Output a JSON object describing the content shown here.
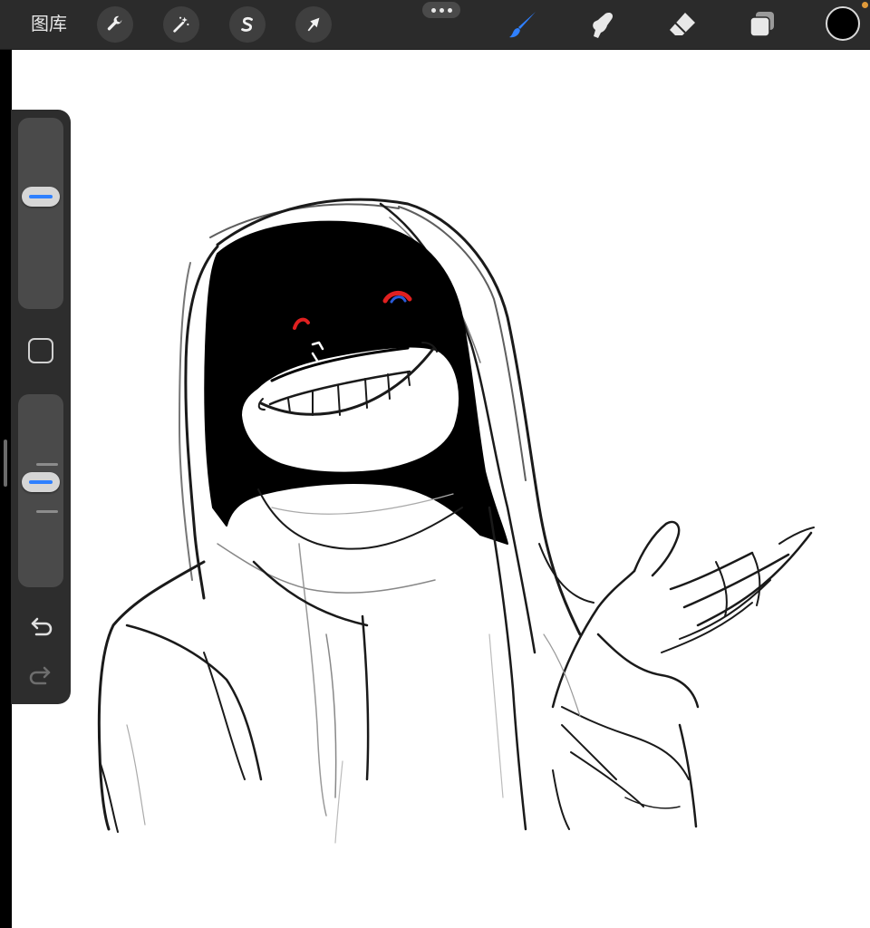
{
  "toolbar": {
    "gallery_label": "图库",
    "actions_icon": "wrench-icon",
    "adjustments_icon": "magic-wand-icon",
    "selection_icon": "selection-s-icon",
    "transform_icon": "arrow-cursor-icon",
    "more_icon": "ellipsis-icon",
    "brush_icon": "brush-icon",
    "smudge_icon": "smudge-finger-icon",
    "eraser_icon": "eraser-icon",
    "layers_icon": "layers-icon",
    "current_color": "#000000",
    "active_tool_color": "#2f80ff"
  },
  "sidebar": {
    "brush_size_level": 0.6,
    "opacity_level": 0.55,
    "modify_icon": "square-icon",
    "undo_icon": "undo-icon",
    "redo_icon": "redo-icon"
  },
  "canvas": {
    "background": "#ffffff",
    "eye_color": "#e02020",
    "pupil_color": "#2a5bd8"
  }
}
